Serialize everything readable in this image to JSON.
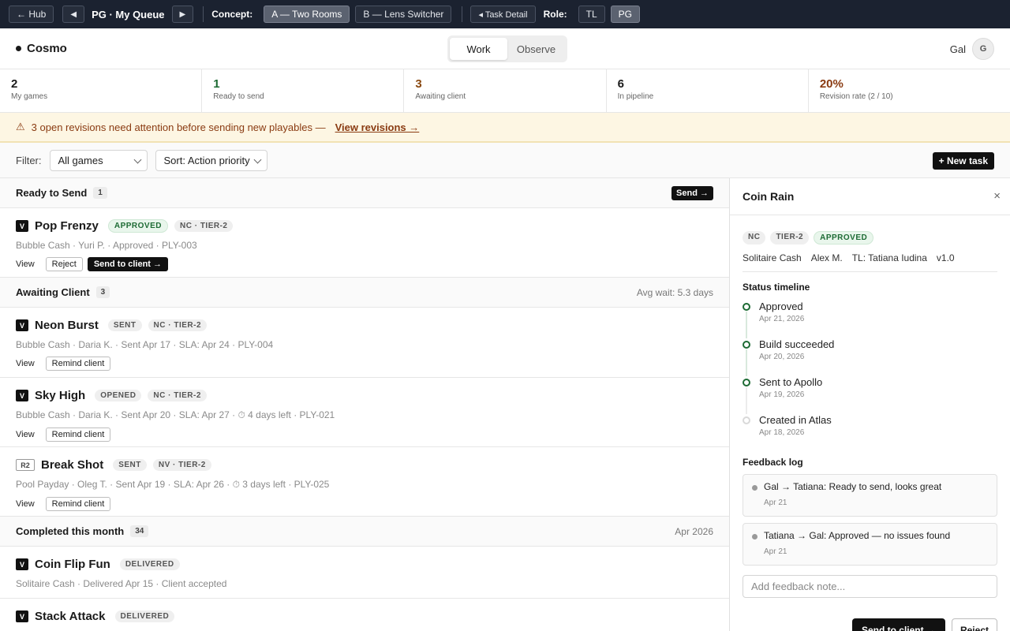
{
  "topbar": {
    "hub": "← Hub",
    "prev": "◀",
    "title": "PG · My Queue",
    "next": "▶",
    "concept_label": "Concept:",
    "concept_a": "A — Two Rooms",
    "concept_b": "B — Lens Switcher",
    "task_detail": "◂ Task Detail",
    "role_label": "Role:",
    "role_tl": "TL",
    "role_pg": "PG"
  },
  "header": {
    "brand": "Cosmo",
    "modes": [
      "Work",
      "Observe"
    ],
    "user_name": "Gal",
    "avatar": "G"
  },
  "stats": [
    {
      "value": "2",
      "label": "My games",
      "color": "#1a1a1a"
    },
    {
      "value": "1",
      "label": "Ready to send",
      "color": "#1d6b34"
    },
    {
      "value": "3",
      "label": "Awaiting client",
      "color": "#8a4a12"
    },
    {
      "value": "6",
      "label": "In pipeline",
      "color": "#1a1a1a"
    },
    {
      "value": "20%",
      "label": "Revision rate (2 / 10)",
      "color": "#8a3b12"
    }
  ],
  "alert": {
    "icon": "⚠",
    "text": "3 open revisions need attention before sending new playables —",
    "link": "View revisions →"
  },
  "filter": {
    "label": "Filter:",
    "game": "All games",
    "sort": "Sort: Action priority",
    "new_task": "+ New task"
  },
  "sections": {
    "ready": {
      "title": "Ready to Send",
      "count": "1",
      "action": "Send →"
    },
    "awaiting": {
      "title": "Awaiting Client",
      "count": "3",
      "right": "Avg wait: 5.3 days"
    },
    "completed": {
      "title": "Completed this month",
      "count": "34",
      "right": "Apr 2026"
    }
  },
  "rows": {
    "pop": {
      "tag": "V",
      "name": "Pop Frenzy",
      "status": "APPROVED",
      "tier": "NC · TIER-2",
      "meta": "Bubble Cash · Yuri P. · Approved · PLY-003",
      "view": "View",
      "reject": "Reject",
      "send": "Send to client →"
    },
    "neon": {
      "tag": "V",
      "name": "Neon Burst",
      "status": "SENT",
      "tier": "NC · TIER-2",
      "meta": "Bubble Cash · Daria K. · Sent Apr 17 · SLA: Apr 24 · PLY-004",
      "view": "View",
      "remind": "Remind client"
    },
    "sky": {
      "tag": "V",
      "name": "Sky High",
      "status": "OPENED",
      "tier": "NC · TIER-2",
      "meta": "Bubble Cash · Daria K. · Sent Apr 20 · SLA: Apr 27 · ⏱ 4 days left · PLY-021",
      "view": "View",
      "remind": "Remind client"
    },
    "break": {
      "tag": "R2",
      "name": "Break Shot",
      "status": "SENT",
      "tier": "NV · TIER-2",
      "meta": "Pool Payday · Oleg T. · Sent Apr 19 · SLA: Apr 26 · ⏱ 3 days left · PLY-025",
      "view": "View",
      "remind": "Remind client"
    },
    "coin": {
      "tag": "V",
      "name": "Coin Flip Fun",
      "status": "DELIVERED",
      "meta": "Solitaire Cash · Delivered Apr 15 · Client accepted"
    },
    "stack": {
      "tag": "V",
      "name": "Stack Attack",
      "status": "DELIVERED"
    }
  },
  "panel": {
    "title": "Coin Rain",
    "close": "×",
    "tags": [
      "NC",
      "TIER-2",
      "APPROVED"
    ],
    "info": [
      "Solitaire Cash",
      "Alex M.",
      "TL: Tatiana Iudina",
      "v1.0"
    ],
    "timeline_title": "Status timeline",
    "timeline": [
      {
        "name": "Approved",
        "date": "Apr 21, 2026"
      },
      {
        "name": "Build succeeded",
        "date": "Apr 20, 2026"
      },
      {
        "name": "Sent to Apollo",
        "date": "Apr 19, 2026"
      },
      {
        "name": "Created in Atlas",
        "date": "Apr 18, 2026"
      }
    ],
    "feedback_title": "Feedback log",
    "feedback": [
      {
        "text": "Gal → Tatiana: Ready to send, looks great",
        "date": "Apr 21"
      },
      {
        "text": "Tatiana → Gal: Approved — no issues found",
        "date": "Apr 21"
      }
    ],
    "input_placeholder": "Add feedback note...",
    "send": "Send to client →",
    "reject": "Reject"
  }
}
